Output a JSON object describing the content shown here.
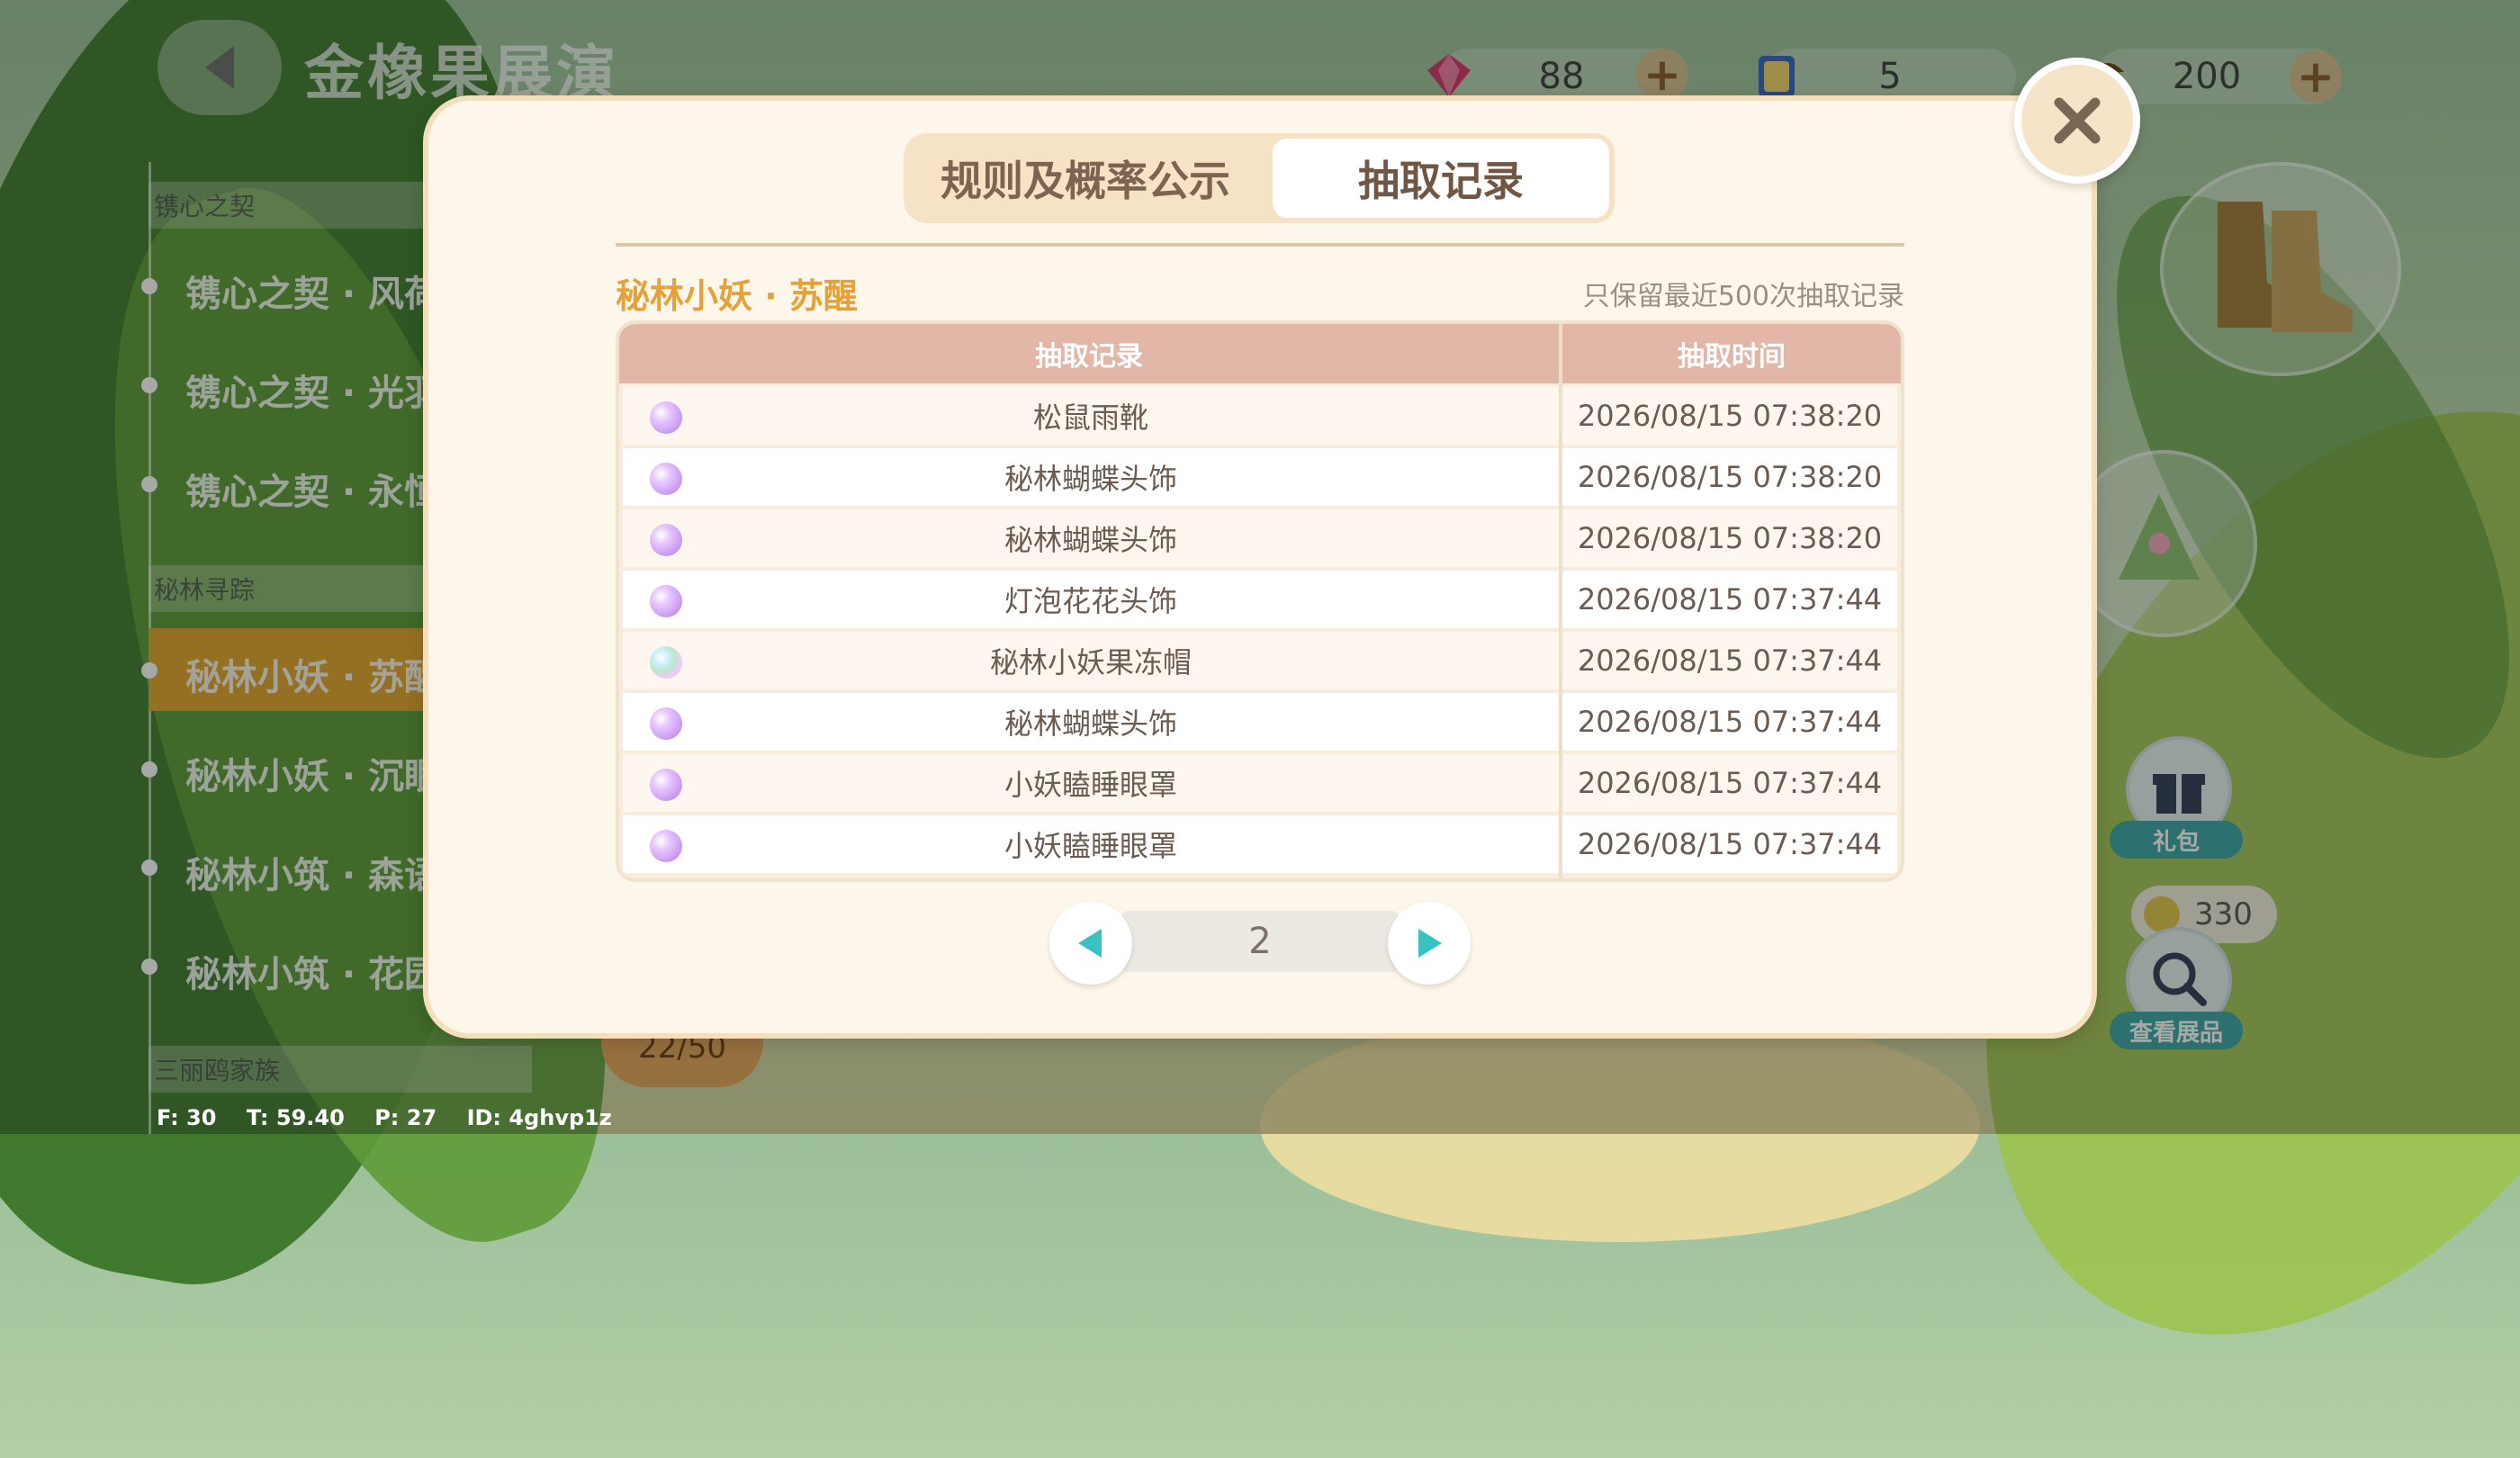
{
  "header": {
    "title": "金橡果展演",
    "resources": [
      {
        "icon": "crystal-icon",
        "value": "88"
      },
      {
        "icon": "ticket-icon",
        "value": "5"
      },
      {
        "icon": "acorn-icon",
        "value": "200"
      }
    ]
  },
  "sidebar": {
    "sections": [
      {
        "header": "镌心之契",
        "items": [
          "镌心之契 · 风荷",
          "镌心之契 · 光羽",
          "镌心之契 · 永恒"
        ]
      },
      {
        "header": "秘林寻踪",
        "items": [
          "秘林小妖 · 苏醒",
          "秘林小妖 · 沉眠",
          "秘林小筑 · 森语",
          "秘林小筑 · 花园"
        ]
      },
      {
        "header": "三丽鸥家族",
        "items": []
      }
    ],
    "active_item": "秘林小妖 · 苏醒"
  },
  "right_panel": {
    "gift_label": "礼包",
    "coin_value": "330",
    "view_label": "查看展品"
  },
  "progress": "22/50",
  "debug": {
    "text": "F: 30    T: 59.40    P: 27    ID: 4ghvp1z"
  },
  "modal": {
    "tabs": [
      {
        "label": "规则及概率公示",
        "active": false
      },
      {
        "label": "抽取记录",
        "active": true
      }
    ],
    "pool_name": "秘林小妖 · 苏醒",
    "keep_note": "只保留最近500次抽取记录",
    "table": {
      "headers": [
        "抽取记录",
        "抽取时间"
      ],
      "rows": [
        {
          "item": "松鼠雨靴",
          "time": "2026/08/15 07:38:20",
          "gem": "purple"
        },
        {
          "item": "秘林蝴蝶头饰",
          "time": "2026/08/15 07:38:20",
          "gem": "purple"
        },
        {
          "item": "秘林蝴蝶头饰",
          "time": "2026/08/15 07:38:20",
          "gem": "purple"
        },
        {
          "item": "灯泡花花头饰",
          "time": "2026/08/15 07:37:44",
          "gem": "purple"
        },
        {
          "item": "秘林小妖果冻帽",
          "time": "2026/08/15 07:37:44",
          "gem": "rainbow"
        },
        {
          "item": "秘林蝴蝶头饰",
          "time": "2026/08/15 07:37:44",
          "gem": "purple"
        },
        {
          "item": "小妖瞌睡眼罩",
          "time": "2026/08/15 07:37:44",
          "gem": "purple"
        },
        {
          "item": "小妖瞌睡眼罩",
          "time": "2026/08/15 07:37:44",
          "gem": "purple"
        }
      ]
    },
    "pager": {
      "page": "2"
    }
  },
  "colors": {
    "accent_orange": "#e6a23a",
    "table_header": "#e3b7a8",
    "pager_arrow": "#38c3c1",
    "modal_bg": "#fdf6ea"
  }
}
